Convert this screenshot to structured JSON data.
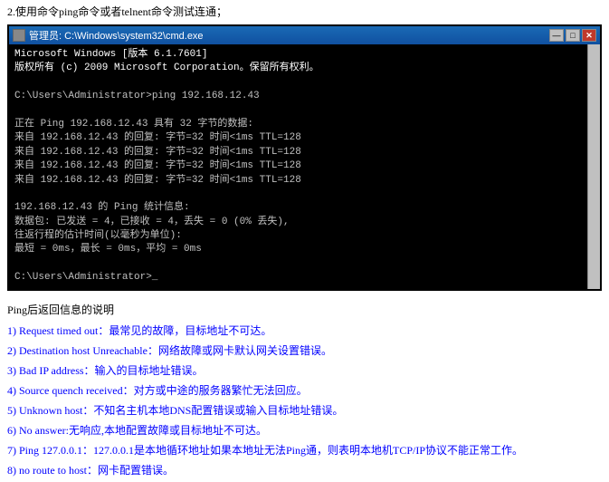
{
  "top_instruction": "2.使用命令ping命令或者telnent命令测试连通；",
  "cmd_window": {
    "titlebar": {
      "title": "管理员: C:\\Windows\\system32\\cmd.exe",
      "icon": "cmd"
    },
    "buttons": {
      "minimize": "—",
      "maximize": "□",
      "close": "✕"
    },
    "content_lines": [
      "Microsoft Windows [版本 6.1.7601]",
      "版权所有 (c) 2009 Microsoft Corporation。保留所有权利。",
      "",
      "C:\\Users\\Administrator>ping 192.168.12.43",
      "",
      "正在 Ping 192.168.12.43 具有 32 字节的数据:",
      "来自 192.168.12.43 的回复: 字节=32 时间<1ms TTL=128",
      "来自 192.168.12.43 的回复: 字节=32 时间<1ms TTL=128",
      "来自 192.168.12.43 的回复: 字节=32 时间<1ms TTL=128",
      "来自 192.168.12.43 的回复: 字节=32 时间<1ms TTL=128",
      "",
      "192.168.12.43 的 Ping 统计信息:",
      "    数据包: 已发送 = 4，已接收 = 4，丢失 = 0 (0% 丢失),",
      "往返行程的估计时间(以毫秒为单位):",
      "    最短 = 0ms，最长 = 0ms，平均 = 0ms",
      "",
      "C:\\Users\\Administrator>_"
    ]
  },
  "ping_info": {
    "title": "Ping后返回信息的说明",
    "items": [
      {
        "number": "1)",
        "text": "Request timed out：最常见的故障，目标地址不可达。"
      },
      {
        "number": "2)",
        "text": "Destination host Unreachable：网络故障或网卡默认网关设置错误。"
      },
      {
        "number": "3)",
        "text": "Bad IP address：输入的目标地址错误。"
      },
      {
        "number": "4)",
        "text": "Source quench received：对方或中途的服务器繁忙无法回应。"
      },
      {
        "number": "5)",
        "text": "Unknown host：不知名主机本地DNS配置错误或输入目标地址错误。"
      },
      {
        "number": "6)",
        "text": "No answer:无响应,本地配置故障或目标地址不可达。"
      },
      {
        "number": "7)",
        "text": "Ping 127.0.0.1：127.0.0.1是本地循环地址如果本地址无法Ping通，则表明本地机TCP/IP协议不能正常工作。"
      },
      {
        "number": "8)",
        "text": "no route to host：网卡配置错误。"
      }
    ]
  }
}
